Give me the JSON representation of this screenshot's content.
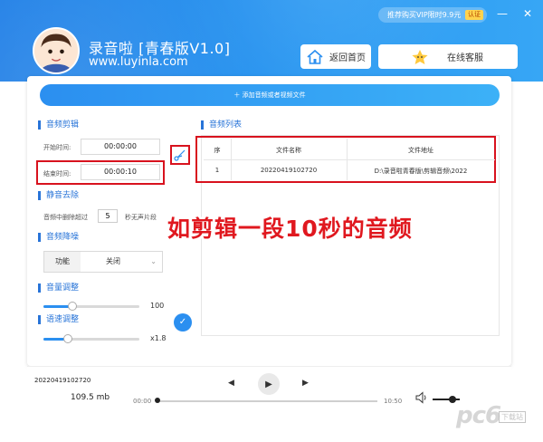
{
  "header": {
    "app_title": "录音啦 [青春版V1.0]",
    "app_url": "www.luyinla.com",
    "vip_text": "推荐购买VIP限时9.9元",
    "vip_badge": "认证",
    "home_button": "返回首页",
    "service_button": "在线客服",
    "minimize": "—",
    "close": "✕"
  },
  "add_files_label": "添加音频或者视频文件",
  "audio_edit": {
    "title": "音频剪辑",
    "start_label": "开始时间:",
    "start_value": "00:00:00",
    "end_label": "结束时间:",
    "end_value": "00:00:10"
  },
  "silence": {
    "title": "静音去除",
    "label_prefix": "音频中删除超过",
    "value": "5",
    "label_suffix": "秒无声片段"
  },
  "denoise": {
    "title": "音频降噪",
    "function_label": "功能",
    "value": "关闭"
  },
  "volume": {
    "title": "音量调整",
    "value": "100",
    "level_fraction": 0.3
  },
  "speed": {
    "title": "语速调整",
    "value": "x1.8",
    "level_fraction": 0.25
  },
  "audio_list": {
    "title": "音频列表",
    "columns": [
      "序",
      "文件名称",
      "文件地址"
    ],
    "rows": [
      {
        "index": "1",
        "name": "20220419102720",
        "path": "D:\\录音啦青春版\\剪辑音频\\2022"
      }
    ]
  },
  "caption": "如剪辑一段10秒的音频",
  "player": {
    "file_name": "20220419102720",
    "file_size": "109.5 mb",
    "time_start": "00:00",
    "time_end": "10:50",
    "progress_fraction": 0.0
  },
  "watermark": {
    "main": "pc6",
    "sub": "下载站"
  },
  "colors": {
    "accent": "#2b8ff0",
    "highlight_red": "#d8121e"
  }
}
